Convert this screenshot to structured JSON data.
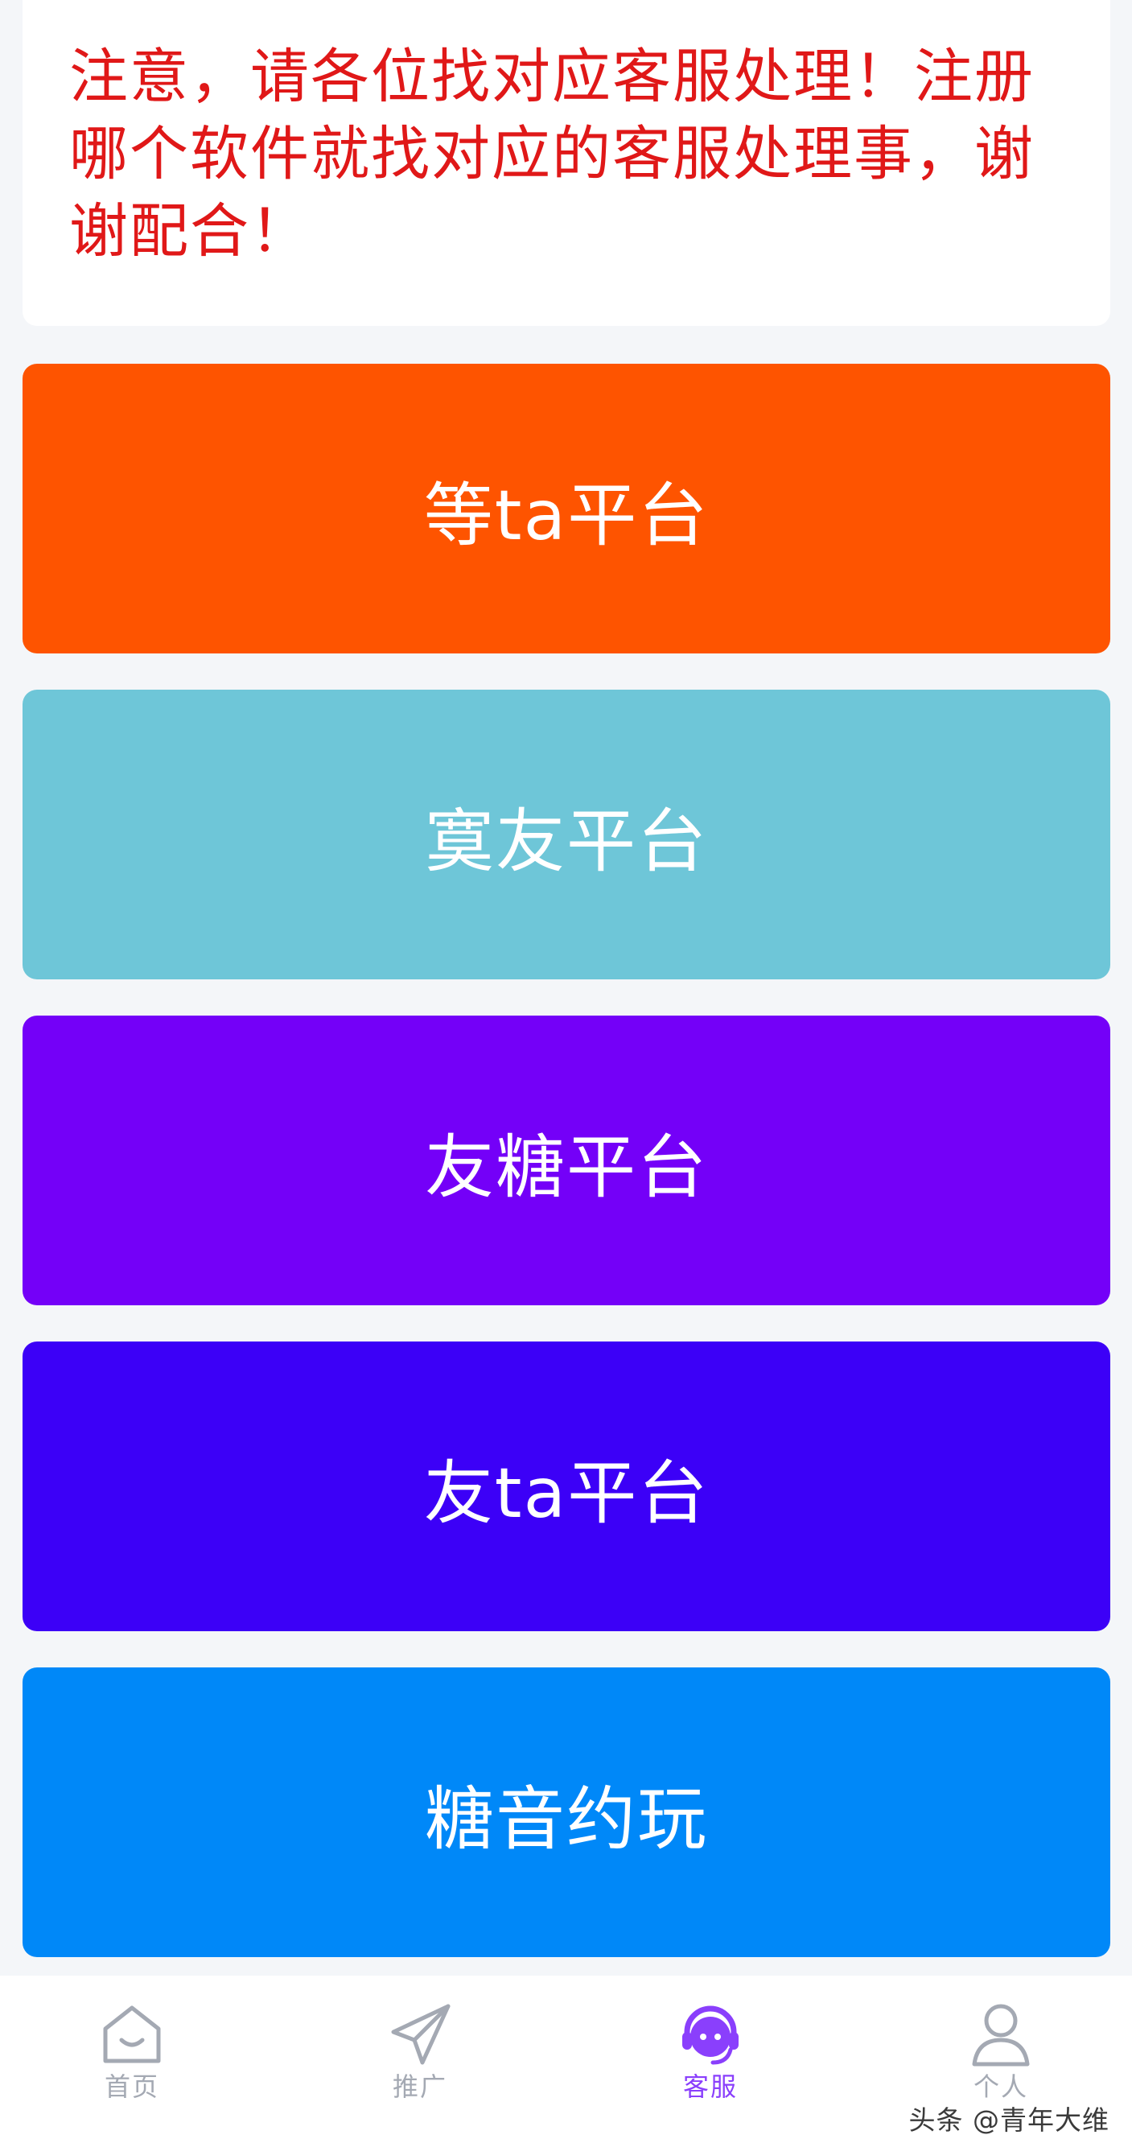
{
  "notice": {
    "text": "注意，请各位找对应客服处理！注册哪个软件就找对应的客服处理事，谢谢配合！",
    "color": "#e01818"
  },
  "platforms": [
    {
      "label": "等ta平台",
      "color": "#fe5400"
    },
    {
      "label": "寞友平台",
      "color": "#6ec6d8"
    },
    {
      "label": "友糖平台",
      "color": "#7400f8"
    },
    {
      "label": "友ta平台",
      "color": "#3c00f7"
    },
    {
      "label": "糖音约玩",
      "color": "#0088f8"
    }
  ],
  "tabbar": {
    "items": [
      {
        "label": "首页",
        "icon": "home-icon",
        "active": false
      },
      {
        "label": "推广",
        "icon": "paper-plane-icon",
        "active": false
      },
      {
        "label": "客服",
        "icon": "headset-icon",
        "active": true
      },
      {
        "label": "个人",
        "icon": "user-icon",
        "active": false
      }
    ],
    "active_color": "#8a3ffc",
    "inactive_color": "#a4a9b3"
  },
  "watermark": "头条 @青年大维"
}
